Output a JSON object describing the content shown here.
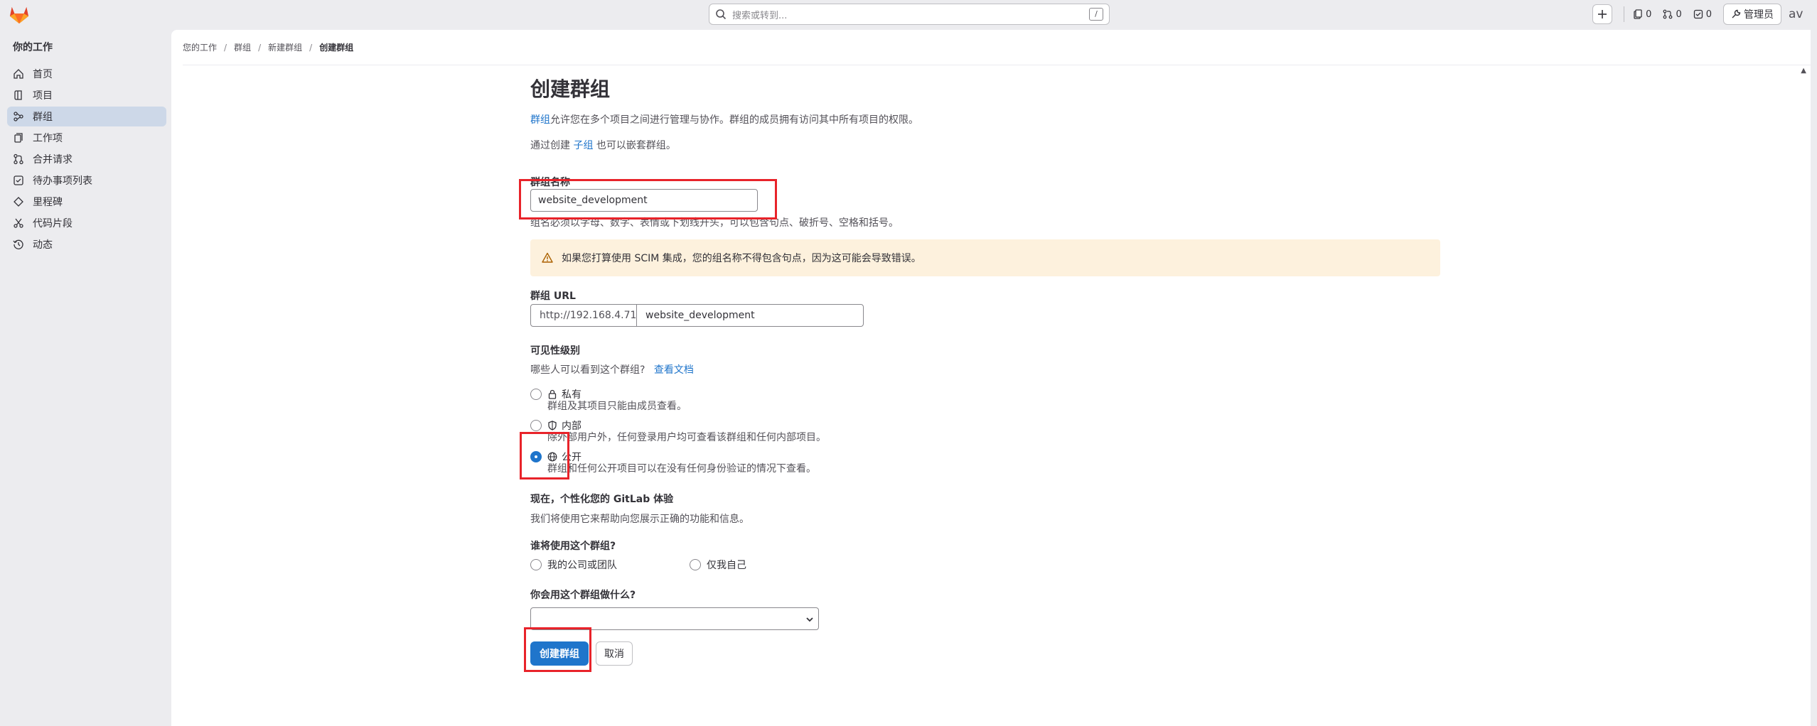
{
  "search": {
    "placeholder": "搜索或转到...",
    "shortcut": "/"
  },
  "topbar": {
    "issues_count": "0",
    "mr_count": "0",
    "todo_count": "0",
    "admin_label": "管理员",
    "avatar_alt": "av"
  },
  "sidebar": {
    "heading": "你的工作",
    "items": [
      {
        "label": "首页",
        "icon": "home-icon"
      },
      {
        "label": "项目",
        "icon": "project-icon"
      },
      {
        "label": "群组",
        "icon": "group-icon",
        "active": true
      },
      {
        "label": "工作项",
        "icon": "work-item-icon"
      },
      {
        "label": "合并请求",
        "icon": "merge-request-icon"
      },
      {
        "label": "待办事项列表",
        "icon": "todo-icon"
      },
      {
        "label": "里程碑",
        "icon": "milestone-icon"
      },
      {
        "label": "代码片段",
        "icon": "snippet-icon"
      },
      {
        "label": "动态",
        "icon": "activity-icon"
      }
    ]
  },
  "breadcrumb": [
    "您的工作",
    "群组",
    "新建群组",
    "创建群组"
  ],
  "page": {
    "title": "创建群组",
    "desc1_link": "群组",
    "desc1_rest": "允许您在多个项目之间进行管理与协作。群组的成员拥有访问其中所有项目的权限。",
    "desc2_before": "通过创建 ",
    "desc2_link": "子组",
    "desc2_after": " 也可以嵌套群组。",
    "name_label": "群组名称",
    "name_value": "website_development",
    "name_help": "组名必须以字母、数字、表情或下划线开头，可以包含句点、破折号、空格和括号。",
    "alert_text": "如果您打算使用 SCIM 集成，您的组名称不得包含句点，因为这可能会导致错误。",
    "url_label": "群组 URL",
    "url_prefix": "http://192.168.4.71/",
    "url_value": "website_development",
    "visibility_label": "可见性级别",
    "visibility_question": "哪些人可以看到这个群组?",
    "visibility_docs_link": "查看文档",
    "visibility_options": [
      {
        "label": "私有",
        "desc": "群组及其项目只能由成员查看。",
        "checked": false,
        "icon": "lock-icon"
      },
      {
        "label": "内部",
        "desc": "除外部用户外，任何登录用户均可查看该群组和任何内部项目。",
        "checked": false,
        "icon": "shield-icon"
      },
      {
        "label": "公开",
        "desc": "群组和任何公开项目可以在没有任何身份验证的情况下查看。",
        "checked": true,
        "icon": "globe-icon"
      }
    ],
    "personalize_title": "现在，个性化您的 GitLab 体验",
    "personalize_desc": "我们将使用它来帮助向您展示正确的功能和信息。",
    "who_label": "谁将使用这个群组?",
    "who_options": [
      "我的公司或团队",
      "仅我自己"
    ],
    "what_label": "你会用这个群组做什么?",
    "what_value": "",
    "create_button": "创建群组",
    "cancel_button": "取消"
  },
  "colors": {
    "primary": "#1f75cb",
    "highlight": "#e8232a",
    "alert_bg": "#fdf1dd",
    "active_nav": "#cdd8e8"
  }
}
